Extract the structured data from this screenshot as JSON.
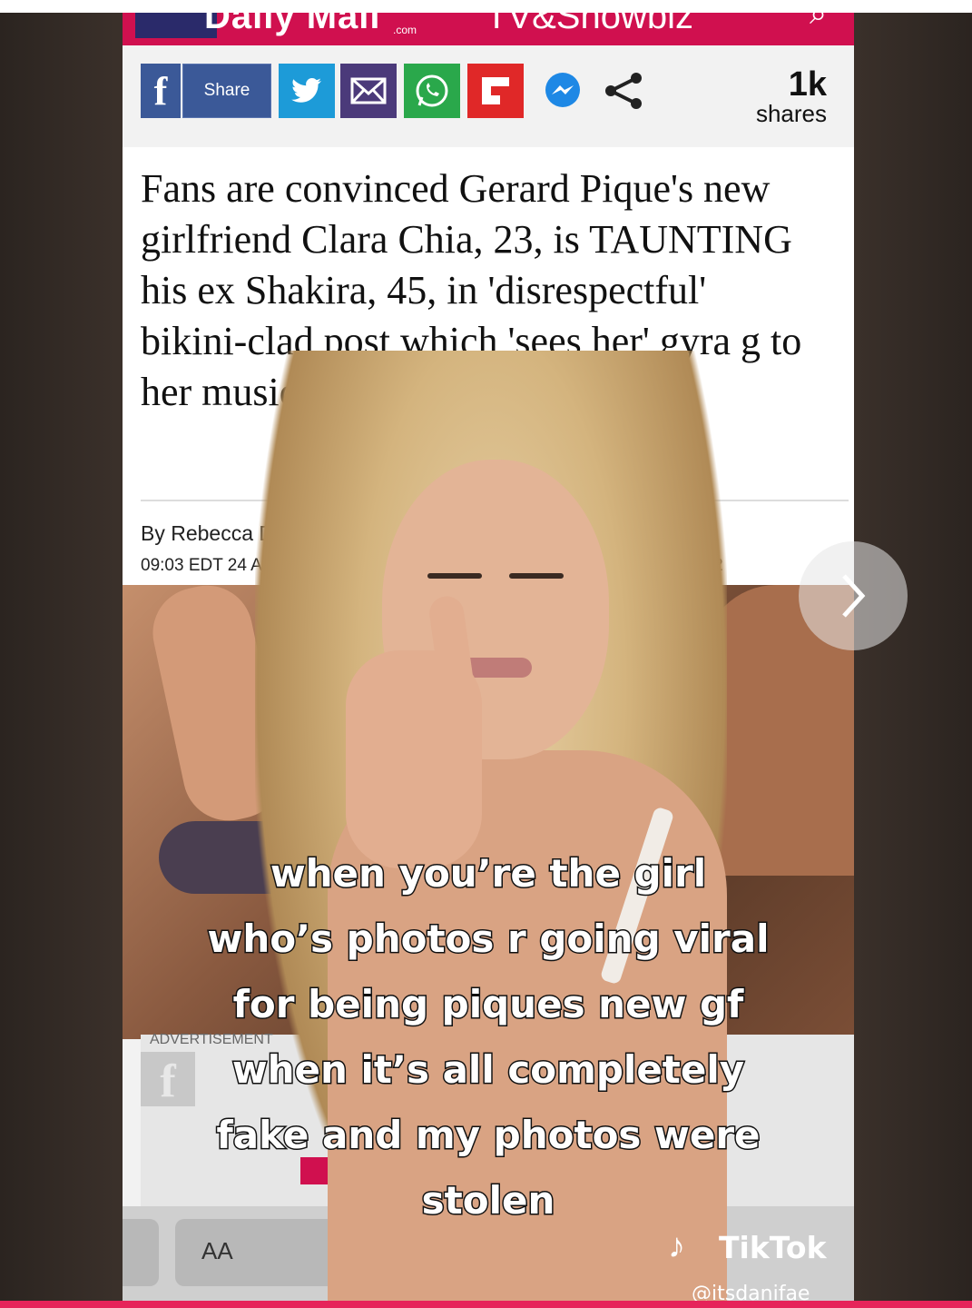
{
  "masthead": {
    "brand": "Daily Mail",
    "brand_sub": ".com",
    "section": "TV&Showbiz"
  },
  "share_bar": {
    "share_label": "Share",
    "shares_count": "1k",
    "shares_label": "shares"
  },
  "article": {
    "headline": "Fans are convinced Gerard Pique's new girlfriend Clara Chia, 23, is TAUNTING his ex Shakira, 45, in 'disrespectful' bikini-clad post which 'sees her' gyra g to her music",
    "byline": "By Rebecca Davison for",
    "dateline": "09:03 EDT 24 Aug 2022 , up",
    "date_tail": "022"
  },
  "ad": {
    "label": "ADVERTISEMENT"
  },
  "keyboard": {
    "text_size_label": "AA"
  },
  "overlay": {
    "caption_lines": [
      "when you’re the girl",
      "who’s photos r going viral",
      "for being piques new gf",
      "when it’s all completely",
      "fake and my photos were",
      "stolen"
    ],
    "tiktok_logo_text": "TikTok",
    "handle": "@itsdanifae"
  },
  "colors": {
    "masthead": "#d0104f",
    "facebook": "#3b5998",
    "twitter": "#1d9bd8",
    "whatsapp": "#2aa84b",
    "flipboard": "#e02828",
    "tiktok_bar": "#e6245a"
  }
}
